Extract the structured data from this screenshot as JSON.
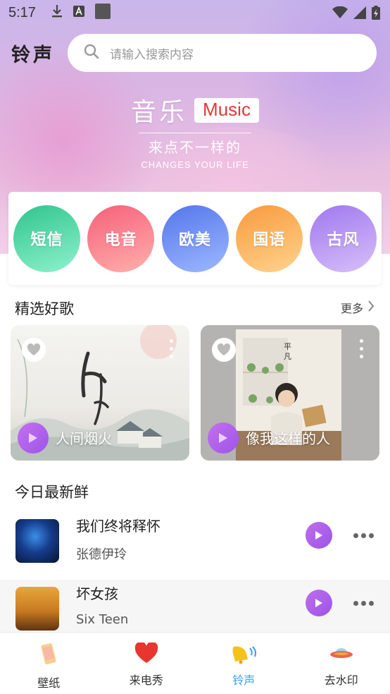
{
  "status_bar": {
    "time": "5:17"
  },
  "header": {
    "title": "铃声",
    "search_placeholder": "请输入搜索内容"
  },
  "hero": {
    "title_cn": "音乐",
    "title_en": "Music",
    "subtitle": "来点不一样的",
    "tagline": "CHANGES YOUR LIFE"
  },
  "categories": [
    {
      "label": "短信",
      "color": "#4fd6a4"
    },
    {
      "label": "电音",
      "color": "#f97a86"
    },
    {
      "label": "欧美",
      "color": "#6d8ef5"
    },
    {
      "label": "国语",
      "color": "#fbac57"
    },
    {
      "label": "古风",
      "color": "#b28cf2"
    }
  ],
  "featured": {
    "title": "精选好歌",
    "more_label": "更多",
    "items": [
      {
        "title": "人间烟火"
      },
      {
        "title": "像我这样的人"
      }
    ]
  },
  "fresh": {
    "title": "今日最新鲜",
    "items": [
      {
        "song": "我们终将释怀",
        "artist": "张德伊玲"
      },
      {
        "song": "坏女孩",
        "artist": "Six Teen"
      }
    ]
  },
  "tabs": [
    {
      "label": "壁纸",
      "icon": "phone-wallpaper-icon",
      "active": false
    },
    {
      "label": "来电秀",
      "icon": "heart-icon",
      "active": false
    },
    {
      "label": "铃声",
      "icon": "bell-icon",
      "active": true
    },
    {
      "label": "去水印",
      "icon": "ufo-icon",
      "active": false
    }
  ],
  "colors": {
    "accent_purple": "#a55ae8",
    "active_tab": "#3f9bf2"
  }
}
